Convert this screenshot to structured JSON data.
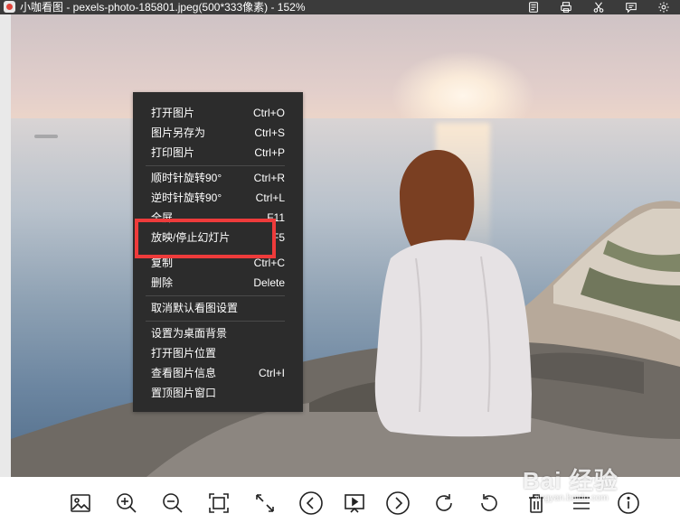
{
  "window": {
    "title": "小咖看图 - pexels-photo-185801.jpeg(500*333像素) - 152%",
    "title_icons": [
      "compress-icon",
      "print-icon",
      "cut-icon",
      "feedback-icon",
      "settings-icon"
    ]
  },
  "context_menu": {
    "items": [
      {
        "label": "打开图片",
        "shortcut": "Ctrl+O"
      },
      {
        "label": "图片另存为",
        "shortcut": "Ctrl+S"
      },
      {
        "label": "打印图片",
        "shortcut": "Ctrl+P"
      },
      {
        "label": "顺时针旋转90°",
        "shortcut": "Ctrl+R"
      },
      {
        "label": "逆时针旋转90°",
        "shortcut": "Ctrl+L"
      },
      {
        "label": "全屏",
        "shortcut": "F11"
      },
      {
        "label": "放映/停止幻灯片",
        "shortcut": "F5"
      },
      {
        "label": "复制",
        "shortcut": "Ctrl+C"
      },
      {
        "label": "删除",
        "shortcut": "Delete"
      },
      {
        "label": "取消默认看图设置",
        "shortcut": ""
      },
      {
        "label": "设置为桌面背景",
        "shortcut": ""
      },
      {
        "label": "打开图片位置",
        "shortcut": ""
      },
      {
        "label": "查看图片信息",
        "shortcut": "Ctrl+I"
      },
      {
        "label": "置顶图片窗口",
        "shortcut": ""
      }
    ],
    "highlighted_item": "放映/停止幻灯片",
    "highlight_color": "#ee3b3b"
  },
  "toolbar": {
    "buttons": [
      "image-icon",
      "zoom-in-icon",
      "zoom-out-icon",
      "fit-window-icon",
      "fullscreen-icon",
      "previous-icon",
      "slideshow-icon",
      "next-icon",
      "rotate-clockwise-icon",
      "rotate-counterclockwise-icon",
      "delete-icon",
      "menu-icon",
      "info-icon"
    ]
  },
  "watermark": {
    "main": "Bai 经验",
    "sub": "jingyan.baidu.com"
  }
}
